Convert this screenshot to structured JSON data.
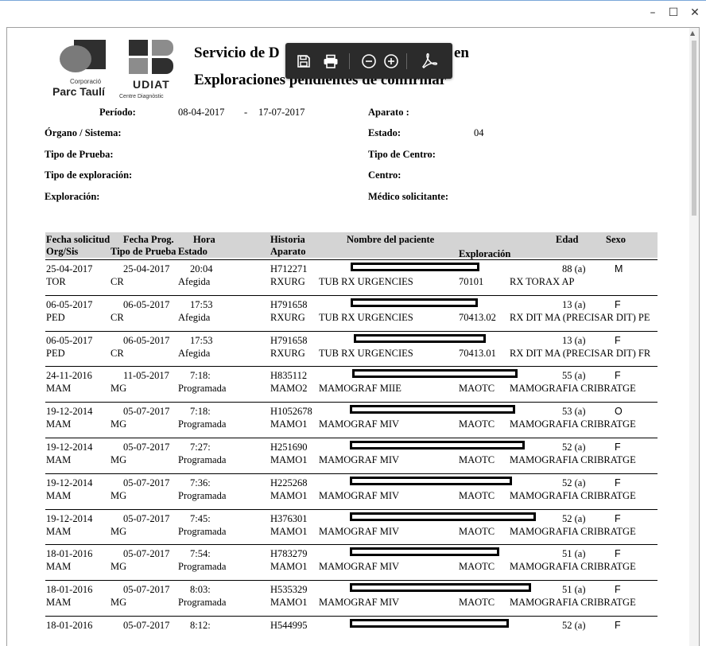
{
  "window": {
    "minimize_glyph": "–",
    "maximize_glyph": "☐",
    "close_glyph": "✕"
  },
  "logo": {
    "line1": "Corporació",
    "line2": "Parc Taulí",
    "udiat": "UDIAT",
    "udiat_sub": "Centre Diagnòstic"
  },
  "report": {
    "title_left": "Servicio de D",
    "title_right": "en",
    "subtitle": "Exploraciones pendientes de confirmar"
  },
  "filters": {
    "periodo_label": "Período:",
    "periodo_from": "08-04-2017",
    "periodo_sep": "-",
    "periodo_to": "17-07-2017",
    "aparato_label": "Aparato :",
    "organo_label": "Órgano / Sistema:",
    "estado_label": "Estado:",
    "estado_value": "04",
    "tipo_prueba_label": "Tipo de Prueba:",
    "tipo_centro_label": "Tipo de Centro:",
    "tipo_exploracion_label": "Tipo de exploración:",
    "centro_label": "Centro:",
    "exploracion_label": "Exploración:",
    "medico_label": "Médico solicitante:"
  },
  "table": {
    "h_fecha_sol": "Fecha solicitud",
    "h_fecha_prog": "Fecha Prog.",
    "h_hora": "Hora",
    "h_historia": "Historia",
    "h_nombre": "Nombre del paciente",
    "h_edad": "Edad",
    "h_sexo": "Sexo",
    "h_orgsis": "Org/Sis",
    "h_tipo": "Tipo de Prueba",
    "h_estado": "Estado",
    "h_aparato": "Aparato",
    "h_exploracion": "Exploración",
    "rows": [
      {
        "fsol": "25-04-2017",
        "fprog": "25-04-2017",
        "hora": "20:04",
        "hist": "H712271",
        "edad": "88 (a)",
        "sexo": "M",
        "org": "TOR",
        "tipo": "CR",
        "estado": "Afegida",
        "aparato": "RXURG",
        "centro": "TUB RX URGENCIES",
        "codigo": "70101",
        "expl": "RX TORAX AP"
      },
      {
        "fsol": "06-05-2017",
        "fprog": "06-05-2017",
        "hora": "17:53",
        "hist": "H791658",
        "edad": "13 (a)",
        "sexo": "F",
        "org": "PED",
        "tipo": "CR",
        "estado": "Afegida",
        "aparato": "RXURG",
        "centro": "TUB RX URGENCIES",
        "codigo": "70413.02",
        "expl": "RX DIT MA (PRECISAR DIT) PE"
      },
      {
        "fsol": "06-05-2017",
        "fprog": "06-05-2017",
        "hora": "17:53",
        "hist": "H791658",
        "edad": "13 (a)",
        "sexo": "F",
        "org": "PED",
        "tipo": "CR",
        "estado": "Afegida",
        "aparato": "RXURG",
        "centro": "TUB RX URGENCIES",
        "codigo": "70413.01",
        "expl": "RX DIT MA (PRECISAR DIT) FR"
      },
      {
        "fsol": "24-11-2016",
        "fprog": "11-05-2017",
        "hora": "7:18:",
        "hist": "H835112",
        "edad": "55 (a)",
        "sexo": "F",
        "org": "MAM",
        "tipo": "MG",
        "estado": "Programada",
        "aparato": "MAMO2",
        "centro": "MAMOGRAF MIIE",
        "codigo": "MAOTC",
        "expl": "MAMOGRAFIA CRIBRATGE"
      },
      {
        "fsol": "19-12-2014",
        "fprog": "05-07-2017",
        "hora": "7:18:",
        "hist": "H1052678",
        "edad": "53 (a)",
        "sexo": "O",
        "org": "MAM",
        "tipo": "MG",
        "estado": "Programada",
        "aparato": "MAMO1",
        "centro": "MAMOGRAF MIV",
        "codigo": "MAOTC",
        "expl": "MAMOGRAFIA CRIBRATGE"
      },
      {
        "fsol": "19-12-2014",
        "fprog": "05-07-2017",
        "hora": "7:27:",
        "hist": "H251690",
        "edad": "52 (a)",
        "sexo": "F",
        "org": "MAM",
        "tipo": "MG",
        "estado": "Programada",
        "aparato": "MAMO1",
        "centro": "MAMOGRAF MIV",
        "codigo": "MAOTC",
        "expl": "MAMOGRAFIA CRIBRATGE"
      },
      {
        "fsol": "19-12-2014",
        "fprog": "05-07-2017",
        "hora": "7:36:",
        "hist": "H225268",
        "edad": "52 (a)",
        "sexo": "F",
        "org": "MAM",
        "tipo": "MG",
        "estado": "Programada",
        "aparato": "MAMO1",
        "centro": "MAMOGRAF MIV",
        "codigo": "MAOTC",
        "expl": "MAMOGRAFIA CRIBRATGE"
      },
      {
        "fsol": "19-12-2014",
        "fprog": "05-07-2017",
        "hora": "7:45:",
        "hist": "H376301",
        "edad": "52 (a)",
        "sexo": "F",
        "org": "MAM",
        "tipo": "MG",
        "estado": "Programada",
        "aparato": "MAMO1",
        "centro": "MAMOGRAF MIV",
        "codigo": "MAOTC",
        "expl": "MAMOGRAFIA CRIBRATGE"
      },
      {
        "fsol": "18-01-2016",
        "fprog": "05-07-2017",
        "hora": "7:54:",
        "hist": "H783279",
        "edad": "51 (a)",
        "sexo": "F",
        "org": "MAM",
        "tipo": "MG",
        "estado": "Programada",
        "aparato": "MAMO1",
        "centro": "MAMOGRAF MIV",
        "codigo": "MAOTC",
        "expl": "MAMOGRAFIA CRIBRATGE"
      },
      {
        "fsol": "18-01-2016",
        "fprog": "05-07-2017",
        "hora": "8:03:",
        "hist": "H535329",
        "edad": "51 (a)",
        "sexo": "F",
        "org": "MAM",
        "tipo": "MG",
        "estado": "Programada",
        "aparato": "MAMO1",
        "centro": "MAMOGRAF MIV",
        "codigo": "MAOTC",
        "expl": "MAMOGRAFIA CRIBRATGE"
      },
      {
        "fsol": "18-01-2016",
        "fprog": "05-07-2017",
        "hora": "8:12:",
        "hist": "H544995",
        "edad": "52 (a)",
        "sexo": "F",
        "org": "",
        "tipo": "",
        "estado": "",
        "aparato": "",
        "centro": "",
        "codigo": "",
        "expl": ""
      }
    ]
  },
  "toolbar": {
    "save": "save-icon",
    "print": "print-icon",
    "zoom_out": "zoom-out-icon",
    "zoom_in": "zoom-in-icon",
    "pdf": "acrobat-icon"
  }
}
